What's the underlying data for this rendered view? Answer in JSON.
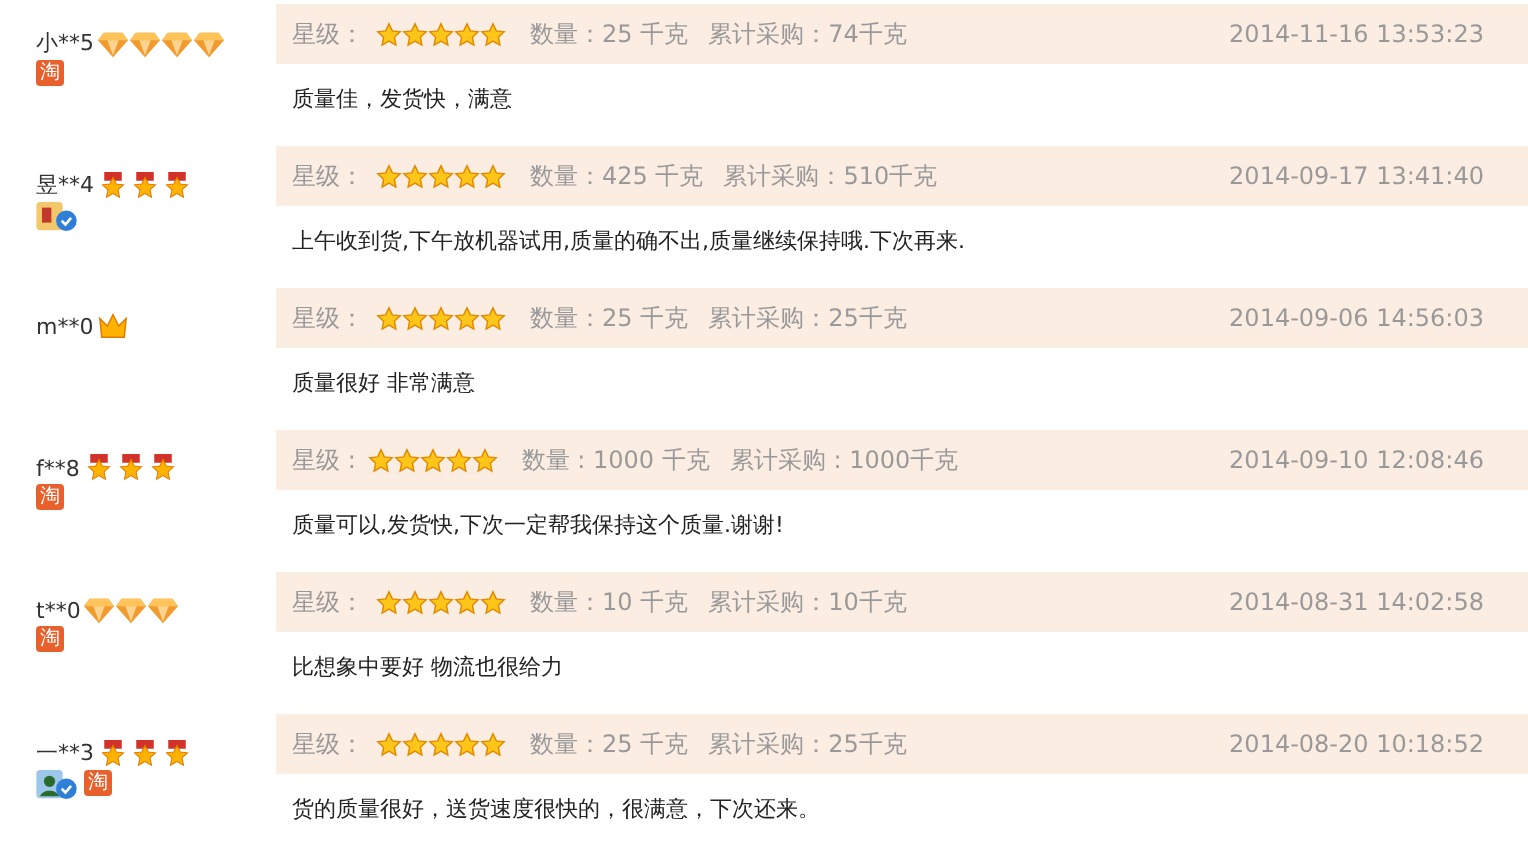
{
  "reviews": [
    {
      "user": "小**5",
      "rank_icons": [
        {
          "kind": "diamond"
        },
        {
          "kind": "diamond"
        },
        {
          "kind": "diamond"
        },
        {
          "kind": "diamond"
        }
      ],
      "tags": [
        {
          "kind": "tao",
          "text": "淘"
        }
      ],
      "rating_label": "星级：",
      "stars": 5,
      "quantity": "数量：25 千克",
      "total": "累计采购：74千克",
      "date": "2014-11-16 13:53:23",
      "comment": "质量佳，发货快，满意"
    },
    {
      "user": "昱**4",
      "rank_icons": [
        {
          "kind": "medal"
        },
        {
          "kind": "medal"
        },
        {
          "kind": "medal"
        }
      ],
      "tags": [
        {
          "kind": "shop"
        }
      ],
      "rating_label": "星级：",
      "stars": 5,
      "quantity": "数量：425 千克",
      "total": "累计采购：510千克",
      "date": "2014-09-17 13:41:40",
      "comment": "上午收到货,下午放机器试用,质量的确不出,质量继续保持哦.下次再来."
    },
    {
      "user": "m**0",
      "rank_icons": [
        {
          "kind": "crown"
        }
      ],
      "rating_label": "星级：",
      "stars": 5,
      "quantity": "数量：25 千克",
      "total": "累计采购：25千克",
      "date": "2014-09-06 14:56:03",
      "comment": "质量很好 非常满意"
    },
    {
      "user": "f**8",
      "rank_icons": [
        {
          "kind": "medal"
        },
        {
          "kind": "medal"
        },
        {
          "kind": "medal"
        }
      ],
      "tags": [
        {
          "kind": "tao",
          "text": "淘"
        }
      ],
      "rating_label": "星级 :",
      "stars": 5,
      "quantity": "数量 : 1000 千克",
      "total": "累计采购 : 1000千克",
      "date": "2014-09-10 12:08:46",
      "comment": "质量可以,发货快,下次一定帮我保持这个质量.谢谢!"
    },
    {
      "user": "t**0",
      "rank_icons": [
        {
          "kind": "diamond"
        },
        {
          "kind": "diamond"
        },
        {
          "kind": "diamond"
        }
      ],
      "tags": [
        {
          "kind": "tao",
          "text": "淘"
        }
      ],
      "rating_label": "星级：",
      "stars": 5,
      "quantity": "数量：10 千克",
      "total": "累计采购：10千克",
      "date": "2014-08-31 14:02:58",
      "comment": "比想象中要好 物流也很给力"
    },
    {
      "user": "一**3",
      "rank_icons": [
        {
          "kind": "medal"
        },
        {
          "kind": "medal"
        },
        {
          "kind": "medal"
        }
      ],
      "tags": [
        {
          "kind": "verified"
        },
        {
          "kind": "tao",
          "text": "淘"
        }
      ],
      "rating_label": "星级：",
      "stars": 5,
      "quantity": "数量：25 千克",
      "total": "累计采购：25千克",
      "date": "2014-08-20 10:18:52",
      "comment": "货的质量很好，送货速度很快的，很满意，下次还来。"
    }
  ]
}
